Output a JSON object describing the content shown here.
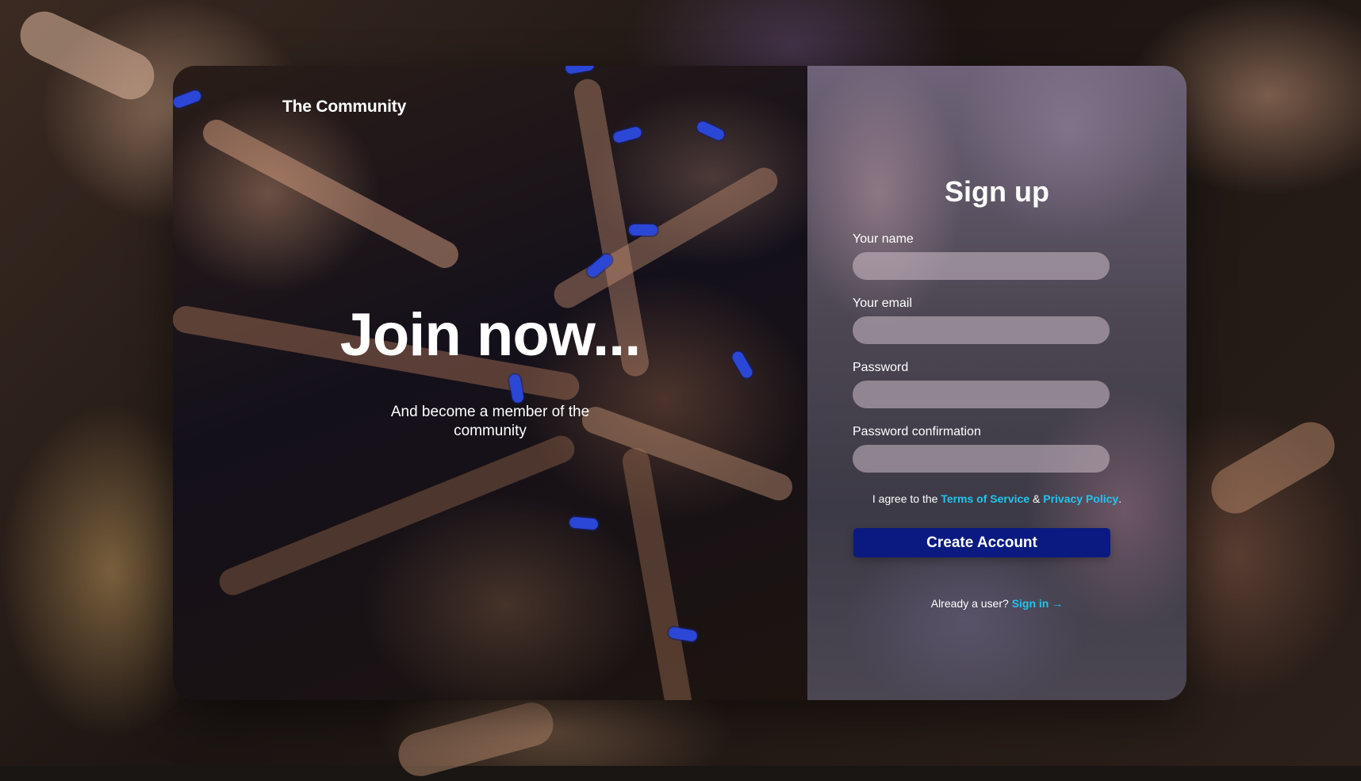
{
  "brand": "The Community",
  "hero": {
    "title": "Join now...",
    "subtitle": "And become a member of the community"
  },
  "signup": {
    "title": "Sign up",
    "fields": [
      {
        "label": "Your name",
        "value": "",
        "placeholder": ""
      },
      {
        "label": "Your email",
        "value": "",
        "placeholder": ""
      },
      {
        "label": "Password",
        "value": "",
        "placeholder": ""
      },
      {
        "label": "Password confirmation",
        "value": "",
        "placeholder": ""
      }
    ],
    "terms_prefix": "I agree to the",
    "terms_link": "Terms of Service",
    "terms_amp": "&",
    "privacy_link": "Privacy Policy",
    "terms_suffix": ".",
    "create_button": "Create Account",
    "signin_prefix": "Already a user?",
    "signin_link": "Sign in",
    "signin_arrow": "→"
  },
  "colors": {
    "accent": "#22c4ee",
    "button": "#0a1a80",
    "wristband": "#2a47d6"
  }
}
